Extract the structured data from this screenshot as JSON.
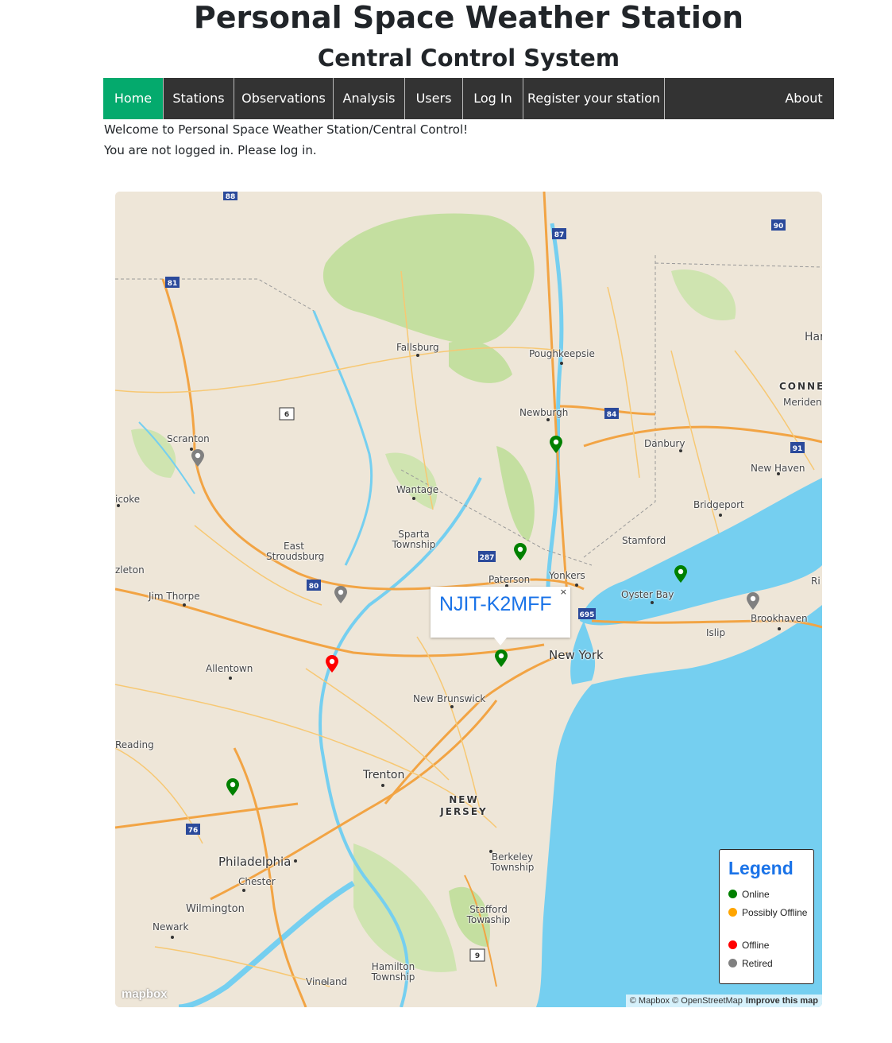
{
  "header": {
    "title": "Personal Space Weather Station",
    "subtitle": "Central Control System"
  },
  "nav": {
    "items": [
      {
        "label": "Home"
      },
      {
        "label": "Stations"
      },
      {
        "label": "Observations"
      },
      {
        "label": "Analysis"
      },
      {
        "label": "Users"
      },
      {
        "label": "Log In"
      },
      {
        "label": "Register your station"
      }
    ],
    "about": "About",
    "active_color": "#04aa6d",
    "bar_color": "#333333"
  },
  "messages": {
    "welcome": "Welcome to Personal Space Weather Station/Central Control!",
    "login_notice": "You are not logged in. Please log in."
  },
  "map": {
    "places": [
      "Fallsburg",
      "Poughkeepsie",
      "Newburgh",
      "Danbury",
      "Scranton",
      "Wantage",
      "Sparta Township",
      "East Stroudsburg",
      "Paterson",
      "Yonkers",
      "Stamford",
      "Bridgeport",
      "New Haven",
      "Meriden",
      "Oyster Bay",
      "Brookhaven",
      "Islip",
      "New York",
      "Jim Thorpe",
      "Allentown",
      "New Brunswick",
      "Reading",
      "Trenton",
      "Philadelphia",
      "Chester",
      "Wilmington",
      "Newark",
      "Vineland",
      "Hamilton Township",
      "Berkeley Township",
      "Stafford Township",
      "NEW JERSEY",
      "CONNEC",
      "Har",
      "Ri",
      "icoke",
      "zleton"
    ],
    "highway_shields": [
      "88",
      "87",
      "90",
      "81",
      "6",
      "84",
      "91",
      "287",
      "80",
      "695",
      "76",
      "9"
    ],
    "popup": {
      "label": "NJIT-K2MFF",
      "close": "×"
    },
    "markers": [
      {
        "status": "online"
      },
      {
        "status": "online"
      },
      {
        "status": "online"
      },
      {
        "status": "online"
      },
      {
        "status": "online"
      },
      {
        "status": "retired"
      },
      {
        "status": "retired"
      },
      {
        "status": "retired"
      },
      {
        "status": "offline"
      }
    ],
    "legend": {
      "title": "Legend",
      "items": [
        {
          "label": "Online",
          "color": "#008000"
        },
        {
          "label": "Possibly Offline",
          "color": "#ffa500"
        },
        {
          "label": "Offline",
          "color": "#ff0000"
        },
        {
          "label": "Retired",
          "color": "#808080"
        }
      ]
    },
    "attribution": "© Mapbox © OpenStreetMap",
    "improve": "Improve this map",
    "logo": "mapbox",
    "colors": {
      "land": "#eee6d8",
      "water": "#75cff0",
      "park": "#c4dfa0",
      "highway": "#f2a444",
      "road": "#f7c873"
    }
  }
}
